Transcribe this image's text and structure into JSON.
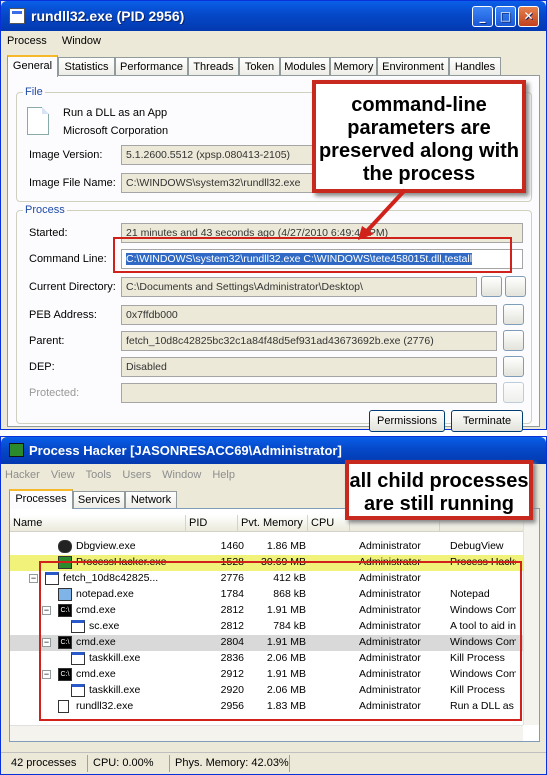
{
  "window1": {
    "title": "rundll32.exe (PID 2956)",
    "caption_buttons": [
      "minimize-icon",
      "maximize-icon",
      "close-icon"
    ],
    "menu": [
      "Process",
      "Window"
    ],
    "tabs": [
      "General",
      "Statistics",
      "Performance",
      "Threads",
      "Token",
      "Modules",
      "Memory",
      "Environment",
      "Handles"
    ],
    "file_group": {
      "label": "File",
      "description": "Run a DLL as an App",
      "company": "Microsoft Corporation",
      "image_version_label": "Image Version:",
      "image_version": "5.1.2600.5512 (xpsp.080413-2105)",
      "image_file_name_label": "Image File Name:",
      "image_file_name": "C:\\WINDOWS\\system32\\rundll32.exe"
    },
    "process_group": {
      "label": "Process",
      "started_label": "Started:",
      "started": "21 minutes and 43 seconds ago (4/27/2010 6:49:41 PM)",
      "command_line_label": "Command Line:",
      "command_line": "C:\\WINDOWS\\system32\\rundll32.exe C:\\WINDOWS\\tete458015t.dll,testall",
      "current_directory_label": "Current Directory:",
      "current_directory": "C:\\Documents and Settings\\Administrator\\Desktop\\",
      "peb_label": "PEB Address:",
      "peb": "0x7ffdb000",
      "parent_label": "Parent:",
      "parent": "fetch_10d8c42825bc32c1a84f48d5ef931ad43673692b.exe (2776)",
      "dep_label": "DEP:",
      "dep": "Disabled",
      "protected_label": "Protected:",
      "protected": ""
    },
    "buttons": {
      "permissions": "Permissions",
      "terminate": "Terminate"
    }
  },
  "callout1": {
    "line1": "command-line",
    "line2": "parameters are",
    "line3": "preserved along with",
    "line4": "the process"
  },
  "window2": {
    "title": "Process Hacker [JASONRESACC69\\Administrator]",
    "menu": [
      "Hacker",
      "View",
      "Tools",
      "Users",
      "Window",
      "Help"
    ],
    "tabs": [
      "Processes",
      "Services",
      "Network"
    ],
    "columns": [
      "Name",
      "PID",
      "Pvt. Memory",
      "CPU",
      "",
      ""
    ],
    "rows": [
      {
        "name": "Dbgview.exe",
        "pid": "1460",
        "mem": "1.86 MB",
        "cpu": "",
        "user": "Administrator",
        "desc": "DebugView",
        "icon": "dbg",
        "indent": 2,
        "toggle": "",
        "bg": "#ffffff"
      },
      {
        "name": "ProcessHacker.exe",
        "pid": "1528",
        "mem": "30.69 MB",
        "cpu": "",
        "user": "Administrator",
        "desc": "Process Hacker",
        "icon": "ph",
        "indent": 2,
        "toggle": "",
        "bg": "#f0f27a"
      },
      {
        "name": "fetch_10d8c42825...",
        "pid": "2776",
        "mem": "412 kB",
        "cpu": "",
        "user": "Administrator",
        "desc": "",
        "icon": "win",
        "indent": 1,
        "toggle": "−",
        "bg": "#ffffff"
      },
      {
        "name": "notepad.exe",
        "pid": "1784",
        "mem": "868 kB",
        "cpu": "",
        "user": "Administrator",
        "desc": "Notepad",
        "icon": "note",
        "indent": 2,
        "toggle": "",
        "bg": "#ffffff"
      },
      {
        "name": "cmd.exe",
        "pid": "2812",
        "mem": "1.91 MB",
        "cpu": "",
        "user": "Administrator",
        "desc": "Windows Com",
        "icon": "cmd",
        "indent": 2,
        "toggle": "−",
        "bg": "#ffffff"
      },
      {
        "name": "sc.exe",
        "pid": "2812",
        "mem": "784 kB",
        "cpu": "",
        "user": "Administrator",
        "desc": "A tool to aid in",
        "icon": "win",
        "indent": 3,
        "toggle": "",
        "bg": "#ffffff"
      },
      {
        "name": "cmd.exe",
        "pid": "2804",
        "mem": "1.91 MB",
        "cpu": "",
        "user": "Administrator",
        "desc": "Windows Com",
        "icon": "cmd",
        "indent": 2,
        "toggle": "−",
        "bg": "#d9d9d9"
      },
      {
        "name": "taskkill.exe",
        "pid": "2836",
        "mem": "2.06 MB",
        "cpu": "",
        "user": "Administrator",
        "desc": "Kill Process",
        "icon": "win",
        "indent": 3,
        "toggle": "",
        "bg": "#ffffff"
      },
      {
        "name": "cmd.exe",
        "pid": "2912",
        "mem": "1.91 MB",
        "cpu": "",
        "user": "Administrator",
        "desc": "Windows Com",
        "icon": "cmd",
        "indent": 2,
        "toggle": "−",
        "bg": "#ffffff"
      },
      {
        "name": "taskkill.exe",
        "pid": "2920",
        "mem": "2.06 MB",
        "cpu": "",
        "user": "Administrator",
        "desc": "Kill Process",
        "icon": "win",
        "indent": 3,
        "toggle": "",
        "bg": "#ffffff"
      },
      {
        "name": "rundll32.exe",
        "pid": "2956",
        "mem": "1.83 MB",
        "cpu": "",
        "user": "Administrator",
        "desc": "Run a DLL as",
        "icon": "doc",
        "indent": 2,
        "toggle": "",
        "bg": "#ffffff"
      }
    ],
    "highlight_color": "#f0f27a",
    "status": {
      "processes": "42 processes",
      "cpu": "CPU: 0.00%",
      "memory": "Phys. Memory: 42.03%"
    }
  },
  "callout2": {
    "line1": "all child processes",
    "line2": "are still running"
  },
  "colors": {
    "accent": "#0548c8",
    "annotation": "#d0211a",
    "selection": "#316ac5"
  }
}
